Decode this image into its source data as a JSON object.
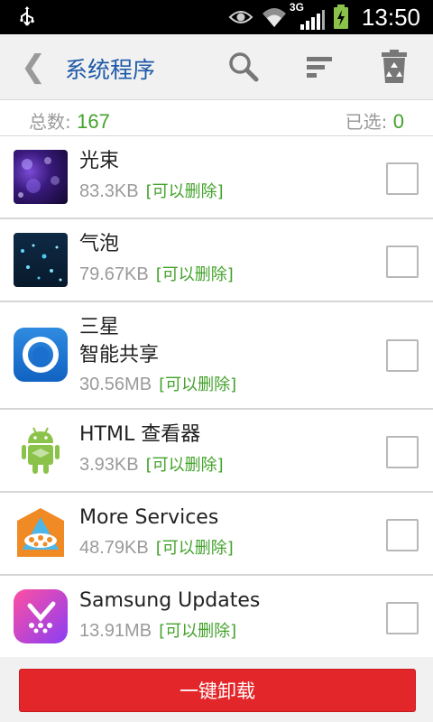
{
  "status_bar": {
    "network": "3G",
    "time": "13:50"
  },
  "action_bar": {
    "back_glyph": "❮",
    "title": "系统程序",
    "icons": [
      "search-icon",
      "sort-icon",
      "recycle-bin-icon"
    ]
  },
  "summary": {
    "total_label": "总数: ",
    "total_value": "167",
    "selected_label": "已选: ",
    "selected_value": "0"
  },
  "apps": [
    {
      "name": "光束",
      "size": "83.3KB",
      "tag": "[可以删除]",
      "checked": false
    },
    {
      "name": "气泡",
      "size": "79.67KB",
      "tag": "[可以删除]",
      "checked": false
    },
    {
      "name": "三星\n智能共享",
      "name_line1": "三星",
      "name_line2": "智能共享",
      "size": "30.56MB",
      "tag": "[可以删除]",
      "checked": false
    },
    {
      "name": "HTML 查看器",
      "size": "3.93KB",
      "tag": "[可以删除]",
      "checked": false
    },
    {
      "name": "More Services",
      "size": "48.79KB",
      "tag": "[可以删除]",
      "checked": false
    },
    {
      "name": "Samsung Updates",
      "size": "13.91MB",
      "tag": "[可以删除]",
      "checked": false
    }
  ],
  "bottom": {
    "uninstall_label": "一键卸载"
  },
  "colors": {
    "title": "#1e5aa7",
    "accent_green": "#43a22b",
    "button_red": "#e3262a"
  }
}
